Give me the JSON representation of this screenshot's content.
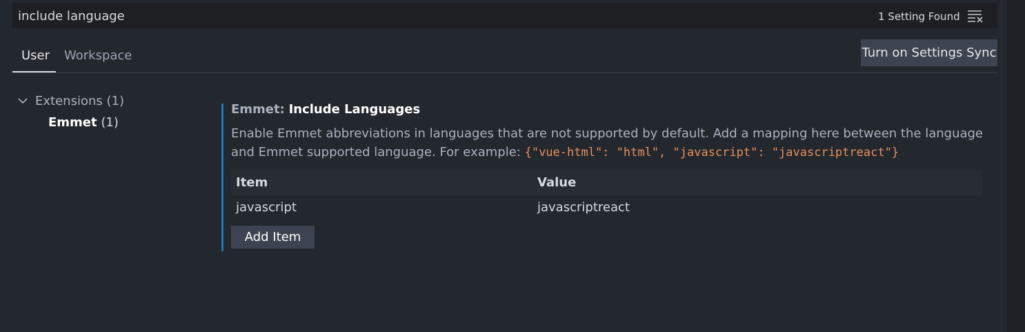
{
  "search": {
    "value": "include language",
    "result_count": "1 Setting Found"
  },
  "tabs": [
    {
      "label": "User",
      "active": true
    },
    {
      "label": "Workspace",
      "active": false
    }
  ],
  "sync_button_label": "Turn on Settings Sync",
  "tree": {
    "extensions_label": "Extensions (1)",
    "child_name": "Emmet",
    "child_count": "(1)"
  },
  "setting": {
    "category": "Emmet:",
    "name": "Include Languages",
    "description_part1": "Enable Emmet abbreviations in languages that are not supported by default. Add a mapping here between the language and Emmet supported language. For example:",
    "description_code": "{\"vue-html\": \"html\", \"javascript\": \"javascriptreact\"}",
    "table": {
      "headers": [
        "Item",
        "Value"
      ],
      "rows": [
        {
          "item": "javascript",
          "value": "javascriptreact"
        }
      ]
    },
    "add_item_label": "Add Item"
  },
  "colors": {
    "background": "#23272e",
    "focus_border": "#1f7ab5",
    "code_text": "#e5915d"
  }
}
